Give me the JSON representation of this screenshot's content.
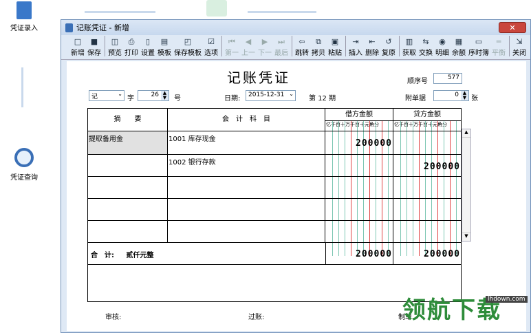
{
  "desktop": {
    "voucher_entry_label": "凭证录入",
    "voucher_query_label": "凭证查询"
  },
  "window": {
    "title": "记账凭证 - 新增",
    "close_label": "✕"
  },
  "toolbar": {
    "new": "新增",
    "save": "保存",
    "preview": "预览",
    "print": "打印",
    "settings": "设置",
    "template": "模板",
    "save_template": "保存模板",
    "options": "选项",
    "first": "第一",
    "prev": "上一",
    "next": "下一",
    "last": "最后",
    "jump": "跳转",
    "copy": "拷贝",
    "paste": "粘贴",
    "insert": "插入",
    "delete": "删除",
    "restore": "复原",
    "fetch": "获取",
    "exchange": "交换",
    "detail": "明细",
    "balance": "余额",
    "timeline": "序时簿",
    "balance_check": "平衡",
    "close": "关闭"
  },
  "voucher": {
    "title": "记账凭证",
    "seq_label": "顺序号",
    "seq_value": "577",
    "type_value": "记",
    "zi_label": "字",
    "number_value": "26",
    "hao_label": "号",
    "date_label": "日期:",
    "date_value": "2015-12-31",
    "period_label": "第 12 期",
    "attach_label": "附单据",
    "attach_value": "0",
    "zhang_label": "张",
    "col_summary": "摘　　要",
    "col_account": "会　计　科　目",
    "col_debit": "借方金额",
    "col_credit": "贷方金额",
    "digit_headers": "亿千百十万千百十元角分",
    "entries": [
      {
        "summary": "提取备用金",
        "account": "1001 库存现金",
        "debit": "200000",
        "credit": ""
      },
      {
        "summary": "",
        "account": "1002 银行存款",
        "debit": "",
        "credit": "200000"
      }
    ],
    "total_label": "合　计:",
    "total_words": "贰仟元整",
    "total_debit": "200000",
    "total_credit": "200000",
    "review_label": "审核:",
    "post_label": "过账:",
    "maker_label": "制单"
  },
  "watermark": {
    "text": "领航下载",
    "site": "lhdown.com"
  }
}
